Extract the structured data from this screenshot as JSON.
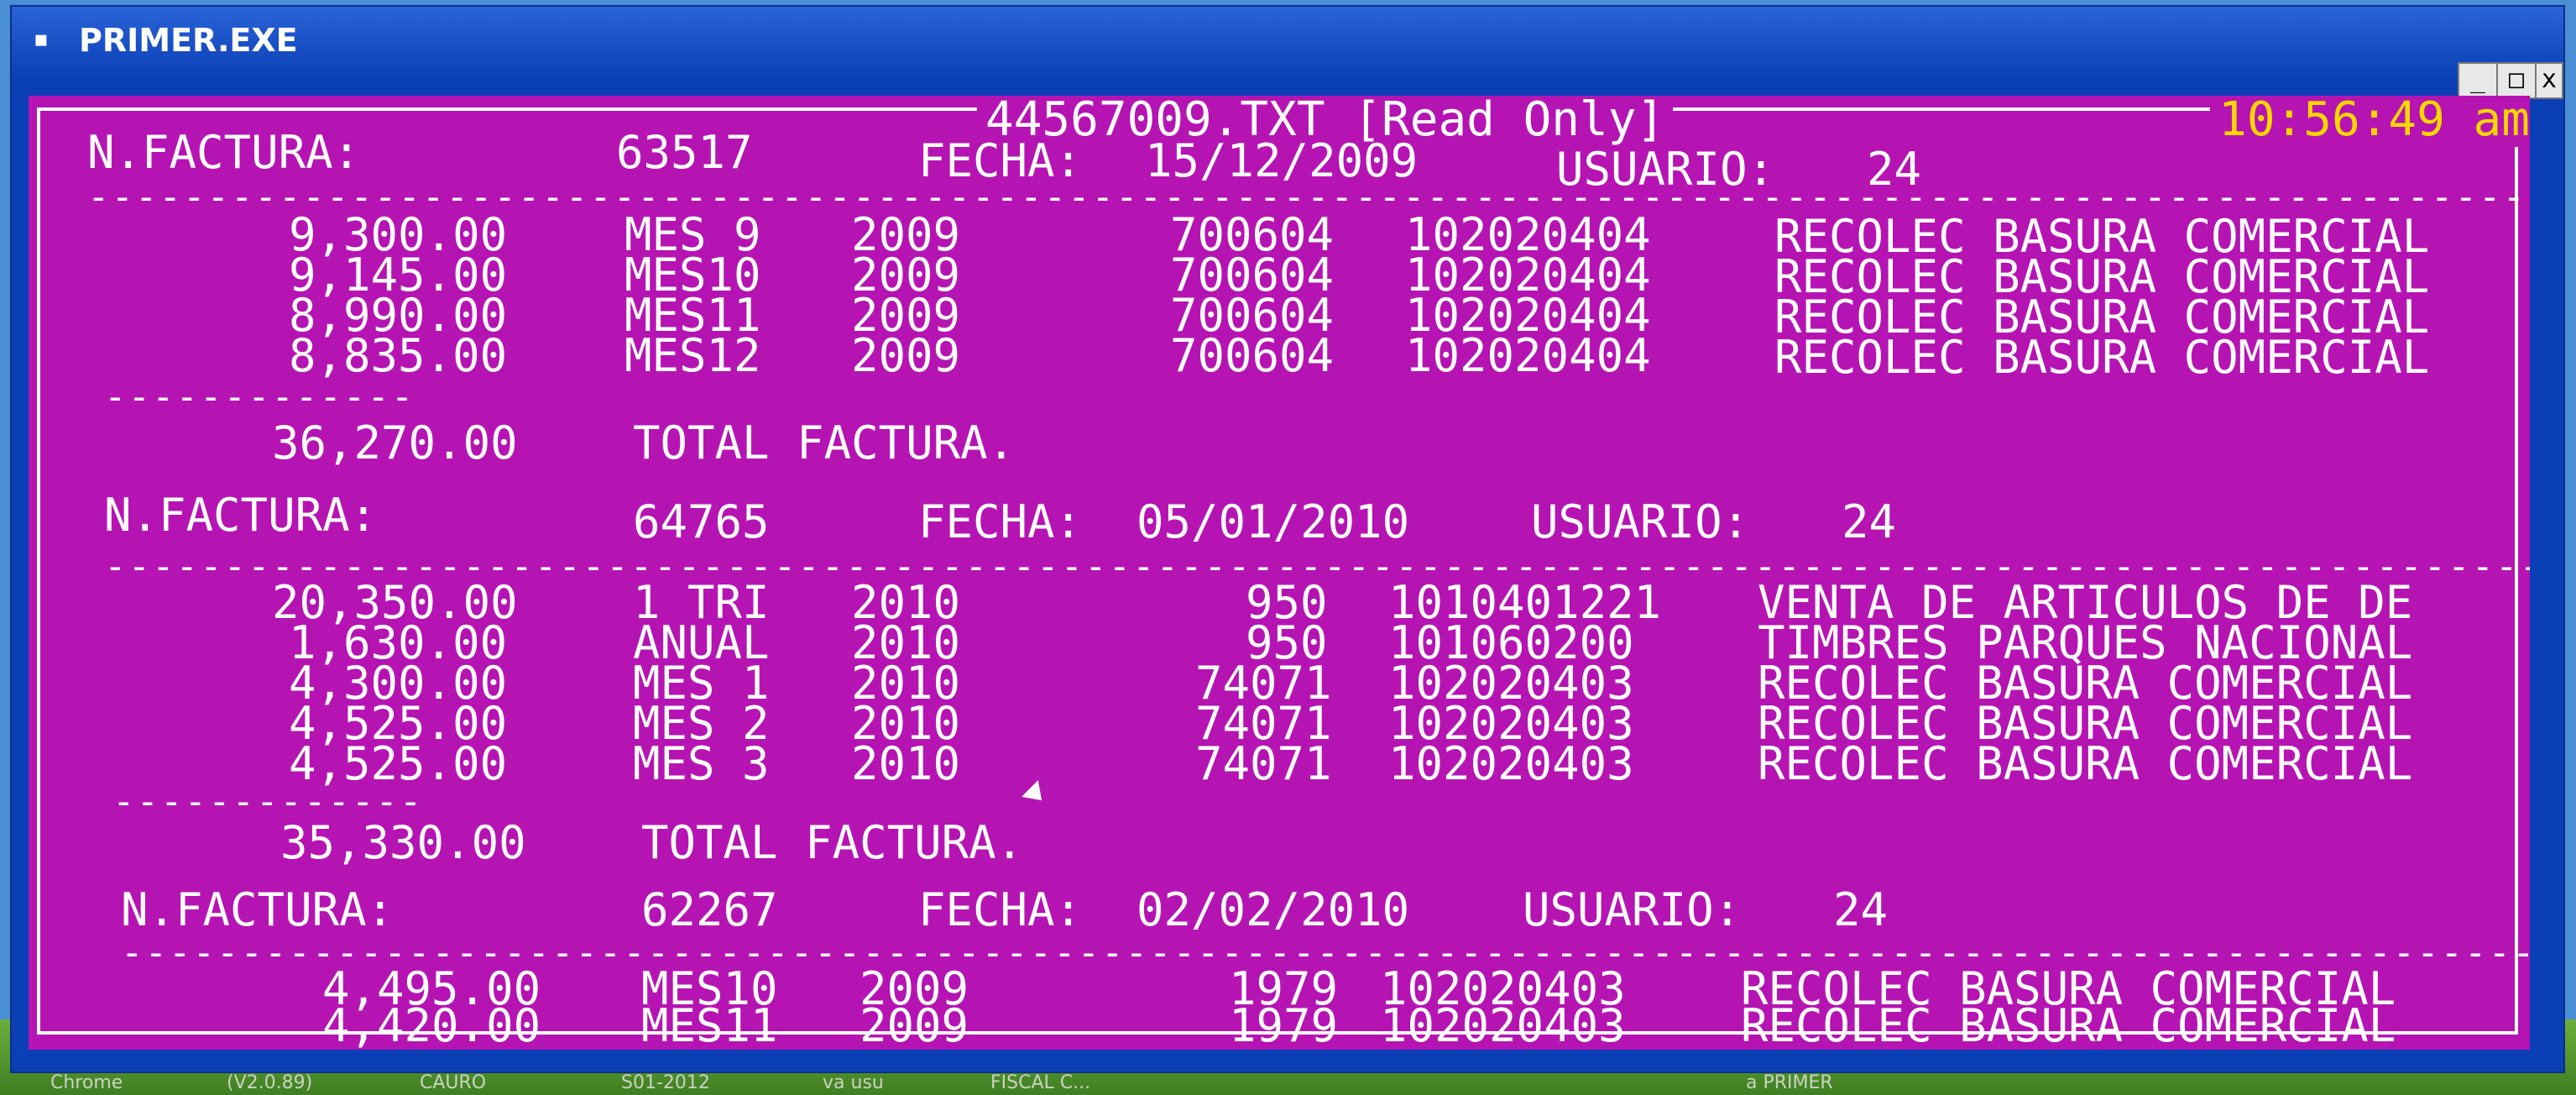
{
  "window": {
    "title": "PRIMER.EXE",
    "icon": "dos-icon",
    "min_label": "_",
    "max_label": "□",
    "close_label": "x"
  },
  "console": {
    "file_title": "44567009.TXT [Read Only]",
    "clock": "10:56:49 am",
    "dash_line": "--------------------------------------------------------------------------------------------------------------",
    "short_dash": "-------------",
    "invoices": [
      {
        "label": "N.FACTURA:",
        "number": "63517",
        "date_label": "FECHA:",
        "date": "15/12/2009",
        "user_label": "USUARIO:",
        "user": "24",
        "lines": [
          {
            "amount": "9,300.00",
            "period": "MES 9",
            "year": "2009",
            "code": "700604",
            "account": "102020404",
            "desc": "RECOLEC BASURA COMERCIAL"
          },
          {
            "amount": "9,145.00",
            "period": "MES10",
            "year": "2009",
            "code": "700604",
            "account": "102020404",
            "desc": "RECOLEC BASURA COMERCIAL"
          },
          {
            "amount": "8,990.00",
            "period": "MES11",
            "year": "2009",
            "code": "700604",
            "account": "102020404",
            "desc": "RECOLEC BASURA COMERCIAL"
          },
          {
            "amount": "8,835.00",
            "period": "MES12",
            "year": "2009",
            "code": "700604",
            "account": "102020404",
            "desc": "RECOLEC BASURA COMERCIAL"
          }
        ],
        "total": "36,270.00",
        "total_label": "TOTAL FACTURA."
      },
      {
        "label": "N.FACTURA:",
        "number": "64765",
        "date_label": "FECHA:",
        "date": "05/01/2010",
        "user_label": "USUARIO:",
        "user": "24",
        "lines": [
          {
            "amount": "20,350.00",
            "period": "1 TRI",
            "year": "2010",
            "code": "950",
            "account": "1010401221",
            "desc": "VENTA DE ARTICULOS DE DE"
          },
          {
            "amount": "1,630.00",
            "period": "ANUAL",
            "year": "2010",
            "code": "950",
            "account": "101060200",
            "desc": "TIMBRES PARQUES NACIONAL"
          },
          {
            "amount": "4,300.00",
            "period": "MES 1",
            "year": "2010",
            "code": "74071",
            "account": "102020403",
            "desc": "RECOLEC BASURA COMERCIAL"
          },
          {
            "amount": "4,525.00",
            "period": "MES 2",
            "year": "2010",
            "code": "74071",
            "account": "102020403",
            "desc": "RECOLEC BASURA COMERCIAL"
          },
          {
            "amount": "4,525.00",
            "period": "MES 3",
            "year": "2010",
            "code": "74071",
            "account": "102020403",
            "desc": "RECOLEC BASURA COMERCIAL"
          }
        ],
        "total": "35,330.00",
        "total_label": "TOTAL FACTURA."
      },
      {
        "label": "N.FACTURA:",
        "number": "62267",
        "date_label": "FECHA:",
        "date": "02/02/2010",
        "user_label": "USUARIO:",
        "user": "24",
        "lines": [
          {
            "amount": "4,495.00",
            "period": "MES10",
            "year": "2009",
            "code": "1979",
            "account": "102020403",
            "desc": "RECOLEC BASURA COMERCIAL"
          },
          {
            "amount": "4,420.00",
            "period": "MES11",
            "year": "2009",
            "code": "1979",
            "account": "102020403",
            "desc": "RECOLEC BASURA COMERCIAL"
          }
        ]
      }
    ]
  },
  "taskbar": {
    "items": [
      "Chrome",
      "(V2.0.89)",
      "CAURO",
      "S01-2012",
      "va usu",
      "FISCAL C...",
      "a PRIMER"
    ]
  }
}
